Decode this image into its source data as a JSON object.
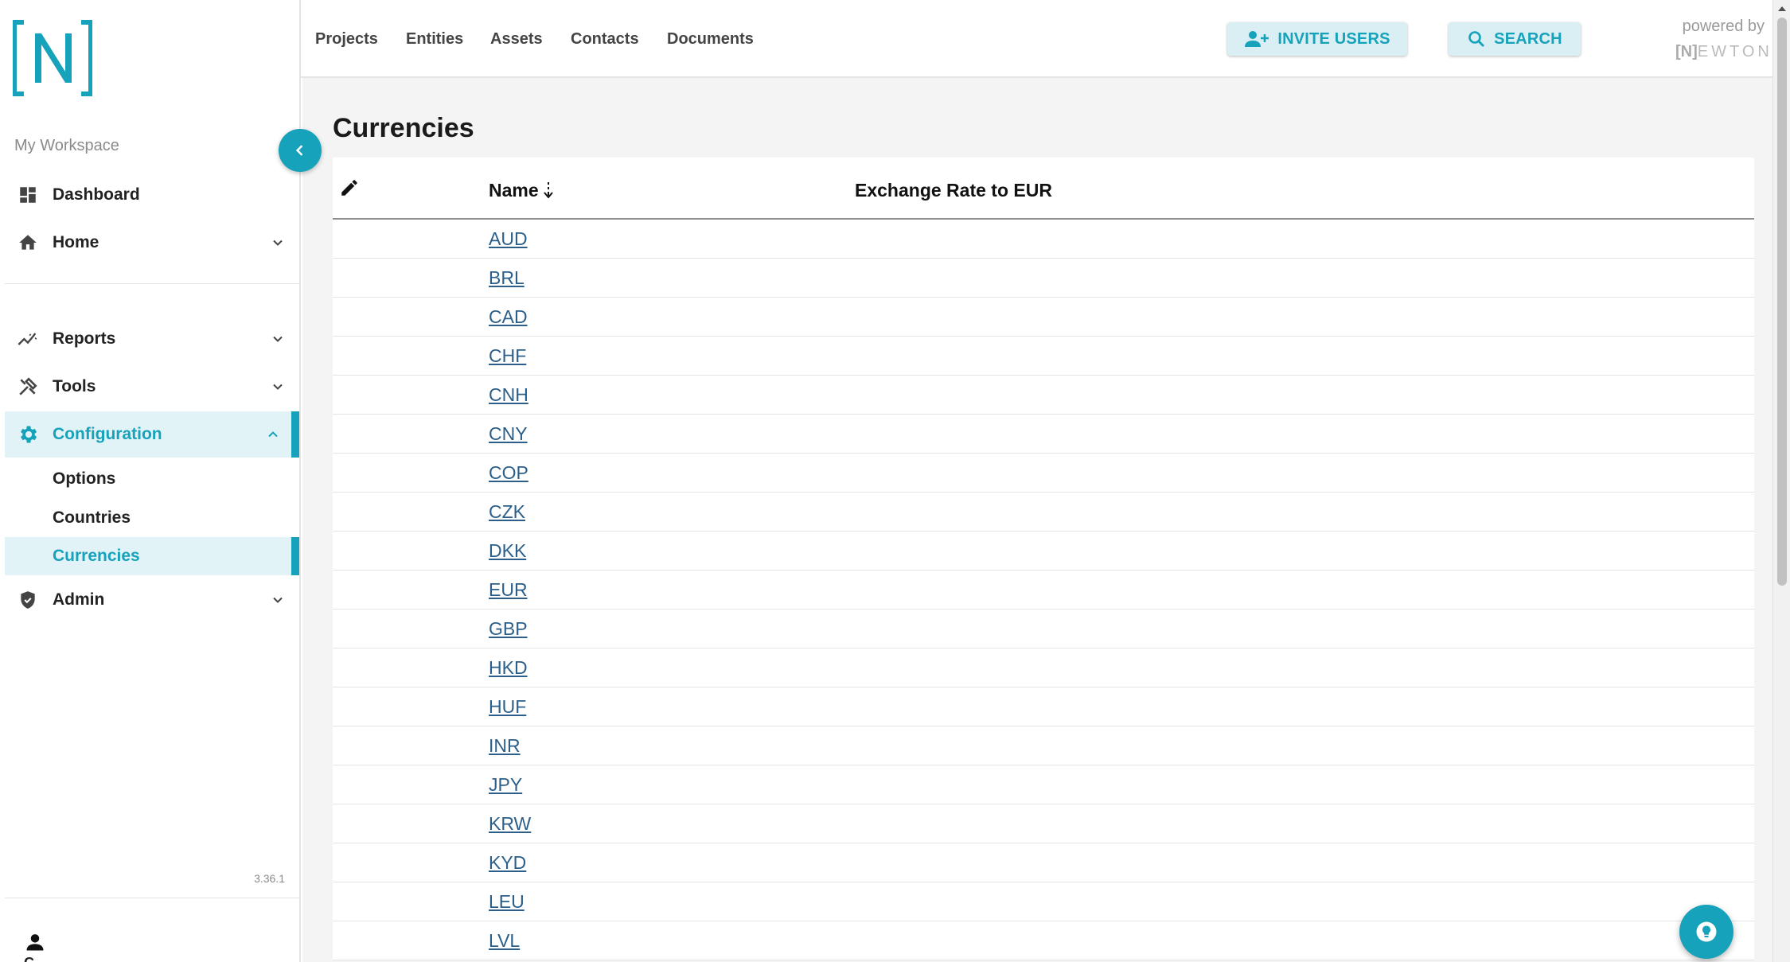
{
  "app": {
    "logo_text": "[N]",
    "version": "3.36.1",
    "powered_by": "powered by",
    "powered_brand": "EWTON",
    "powered_bracket": "[N]",
    "accent_color": "#16a2ba"
  },
  "sidebar": {
    "workspace_label": "My Workspace",
    "items": [
      {
        "label": "Dashboard",
        "icon": "dashboard-icon"
      },
      {
        "label": "Home",
        "icon": "home-icon",
        "expandable": true
      },
      {
        "label": "Reports",
        "icon": "reports-icon",
        "expandable": true
      },
      {
        "label": "Tools",
        "icon": "tools-icon",
        "expandable": true
      },
      {
        "label": "Configuration",
        "icon": "gear-icon",
        "expandable": true,
        "expanded": true,
        "active": true
      },
      {
        "label": "Admin",
        "icon": "shield-icon",
        "expandable": true
      }
    ],
    "config_subitems": [
      {
        "label": "Options"
      },
      {
        "label": "Countries"
      },
      {
        "label": "Currencies",
        "active": true
      }
    ],
    "user_label": "C..."
  },
  "topnav": {
    "links": [
      "Projects",
      "Entities",
      "Assets",
      "Contacts",
      "Documents"
    ],
    "invite_label": "INVITE USERS",
    "search_label": "SEARCH"
  },
  "page": {
    "title": "Currencies",
    "columns": {
      "name": "Name",
      "rate": "Exchange Rate to EUR"
    },
    "rows": [
      "AUD",
      "BRL",
      "CAD",
      "CHF",
      "CNH",
      "CNY",
      "COP",
      "CZK",
      "DKK",
      "EUR",
      "GBP",
      "HKD",
      "HUF",
      "INR",
      "JPY",
      "KRW",
      "KYD",
      "LEU",
      "LVL"
    ]
  }
}
